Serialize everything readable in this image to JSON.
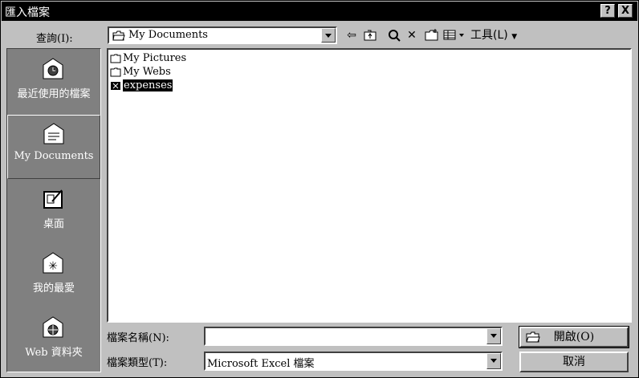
{
  "window": {
    "title": "匯入檔案",
    "help_btn": "?",
    "close_btn": "X"
  },
  "toolbar": {
    "look_in_label": "查詢(I):",
    "look_in_value": "My Documents",
    "tools_label": "工具(L)"
  },
  "places": [
    {
      "label": "最近使用的檔案",
      "icon": "recent-files-icon"
    },
    {
      "label": "My Documents",
      "icon": "my-documents-icon",
      "selected": true
    },
    {
      "label": "桌面",
      "icon": "desktop-icon"
    },
    {
      "label": "我的最愛",
      "icon": "favorites-icon"
    },
    {
      "label": "Web 資料夾",
      "icon": "web-folders-icon"
    }
  ],
  "files": [
    {
      "name": "My Pictures",
      "icon": "folder-icon"
    },
    {
      "name": "My Webs",
      "icon": "folder-icon"
    },
    {
      "name": "expenses",
      "icon": "excel-file-icon",
      "selected": true
    }
  ],
  "bottom": {
    "filename_label": "檔案名稱(N):",
    "filename_value": "",
    "filetype_label": "檔案類型(T):",
    "filetype_value": "Microsoft Excel 檔案",
    "open_button": "開啟(O)",
    "cancel_button": "取消"
  }
}
